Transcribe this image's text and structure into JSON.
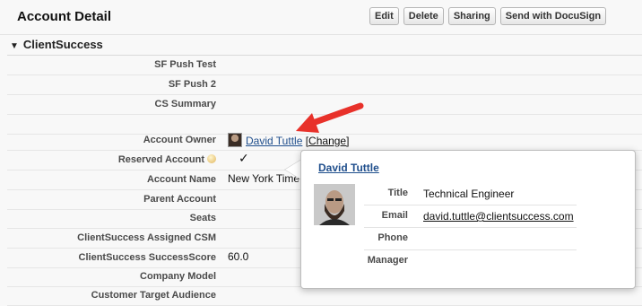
{
  "header": {
    "title": "Account Detail",
    "buttons": {
      "edit": "Edit",
      "delete": "Delete",
      "sharing": "Sharing",
      "docusign": "Send with DocuSign"
    }
  },
  "section": {
    "title": "ClientSuccess",
    "collapse_icon": "triangle-down-icon"
  },
  "fields": [
    {
      "label": "SF Push Test",
      "value": ""
    },
    {
      "label": "SF Push 2",
      "value": ""
    },
    {
      "label": "CS Summary",
      "value": ""
    },
    {
      "label": "",
      "value": ""
    },
    {
      "label": "Account Owner",
      "owner": "David Tuttle",
      "change": "[Change]"
    },
    {
      "label": "Reserved Account",
      "value": "✓"
    },
    {
      "label": "Account Name",
      "value": "New York Time"
    },
    {
      "label": "Parent Account",
      "value": ""
    },
    {
      "label": "Seats",
      "value": ""
    },
    {
      "label": "ClientSuccess Assigned CSM",
      "value": ""
    },
    {
      "label": "ClientSuccess SuccessScore",
      "value": "60.0"
    },
    {
      "label": "Company Model",
      "value": ""
    },
    {
      "label": "Customer Target Audience",
      "value": ""
    }
  ],
  "popup": {
    "name": "David Tuttle",
    "rows": [
      {
        "label": "Title",
        "value": "Technical Engineer"
      },
      {
        "label": "Email",
        "value": "david.tuttle@clientsuccess.com"
      },
      {
        "label": "Phone",
        "value": ""
      },
      {
        "label": "Manager",
        "value": ""
      }
    ]
  },
  "colors": {
    "link": "#1f4e8c",
    "annotation_arrow": "#e8312a"
  }
}
